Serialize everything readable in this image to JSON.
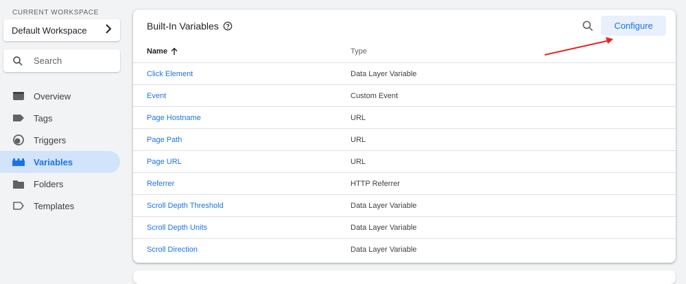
{
  "workspace": {
    "label": "CURRENT WORKSPACE",
    "name": "Default Workspace"
  },
  "search": {
    "placeholder": "Search"
  },
  "nav": {
    "items": [
      {
        "label": "Overview",
        "icon": "overview-icon"
      },
      {
        "label": "Tags",
        "icon": "tag-icon"
      },
      {
        "label": "Triggers",
        "icon": "trigger-icon"
      },
      {
        "label": "Variables",
        "icon": "variables-icon",
        "active": true
      },
      {
        "label": "Folders",
        "icon": "folder-icon"
      },
      {
        "label": "Templates",
        "icon": "template-icon"
      }
    ]
  },
  "panel": {
    "title": "Built-In Variables",
    "configure_label": "Configure",
    "columns": {
      "name": "Name",
      "type": "Type"
    },
    "rows": [
      {
        "name": "Click Element",
        "type": "Data Layer Variable"
      },
      {
        "name": "Event",
        "type": "Custom Event"
      },
      {
        "name": "Page Hostname",
        "type": "URL"
      },
      {
        "name": "Page Path",
        "type": "URL"
      },
      {
        "name": "Page URL",
        "type": "URL"
      },
      {
        "name": "Referrer",
        "type": "HTTP Referrer"
      },
      {
        "name": "Scroll Depth Threshold",
        "type": "Data Layer Variable"
      },
      {
        "name": "Scroll Depth Units",
        "type": "Data Layer Variable"
      },
      {
        "name": "Scroll Direction",
        "type": "Data Layer Variable"
      }
    ]
  },
  "colors": {
    "accent": "#1a73e8",
    "active_bg": "#d2e3fc",
    "annotation_arrow": "#e8251f"
  }
}
